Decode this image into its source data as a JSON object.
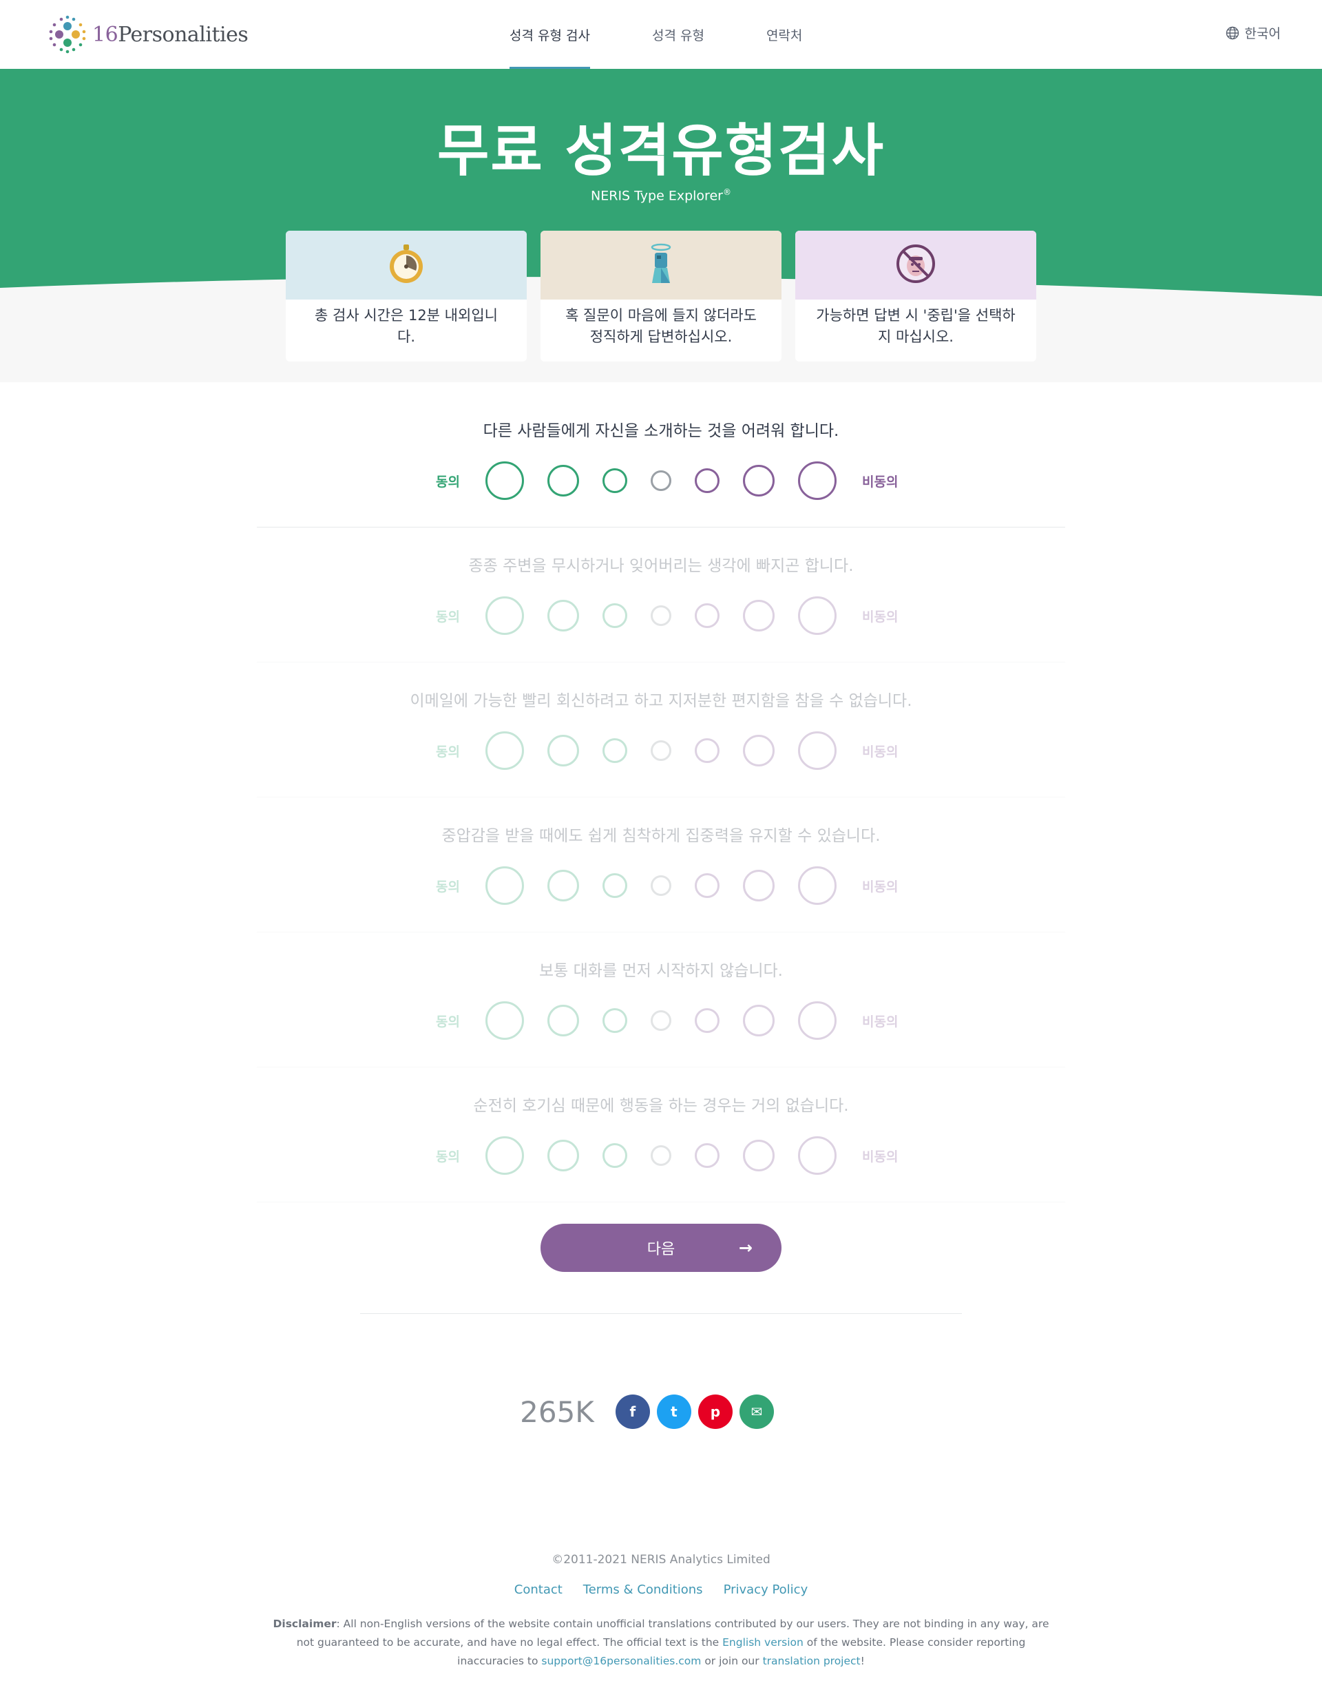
{
  "header": {
    "logo_number": "16",
    "logo_text": "Personalities",
    "nav": [
      {
        "label": "성격 유형 검사",
        "active": true
      },
      {
        "label": "성격 유형",
        "active": false
      },
      {
        "label": "연락처",
        "active": false
      }
    ],
    "language": "한국어"
  },
  "hero": {
    "title": "무료 성격유형검사",
    "subtitle": "NERIS Type Explorer",
    "subtitle_mark": "®",
    "background_color": "#33a474",
    "tips": [
      {
        "icon": "stopwatch-icon",
        "text": "총 검사 시간은 12분 내외입니다.",
        "color": "#d9eaf0"
      },
      {
        "icon": "halo-figure-icon",
        "text": "혹 질문이 마음에 들지 않더라도 정직하게 답변하십시오.",
        "color": "#ede4d6"
      },
      {
        "icon": "no-neutral-face-icon",
        "text": "가능하면 답변 시 '중립'을 선택하지 마십시오.",
        "color": "#ecdff2"
      }
    ]
  },
  "scale": {
    "agree_label": "동의",
    "disagree_label": "비동의",
    "agree_color": "#33a474",
    "disagree_color": "#88619a"
  },
  "questions": [
    {
      "text": "다른 사람들에게 자신을 소개하는 것을 어려워 합니다.",
      "active": true
    },
    {
      "text": "종종 주변을 무시하거나 잊어버리는 생각에 빠지곤 합니다.",
      "active": false
    },
    {
      "text": "이메일에 가능한 빨리 회신하려고 하고 지저분한 편지함을 참을 수 없습니다.",
      "active": false
    },
    {
      "text": "중압감을 받을 때에도 쉽게 침착하게 집중력을 유지할 수 있습니다.",
      "active": false
    },
    {
      "text": "보통 대화를 먼저 시작하지 않습니다.",
      "active": false
    },
    {
      "text": "순전히 호기심 때문에 행동을 하는 경우는 거의 없습니다.",
      "active": false
    }
  ],
  "next_button": {
    "label": "다음",
    "arrow": "→",
    "color": "#88619a"
  },
  "share": {
    "count": "265K",
    "buttons": [
      {
        "name": "facebook",
        "icon": "facebook-icon",
        "glyph": "f",
        "color": "#3b5998"
      },
      {
        "name": "twitter",
        "icon": "twitter-icon",
        "glyph": "t",
        "color": "#1da1f2"
      },
      {
        "name": "pinterest",
        "icon": "pinterest-icon",
        "glyph": "p",
        "color": "#e60023"
      },
      {
        "name": "email",
        "icon": "envelope-icon",
        "glyph": "✉",
        "color": "#33a474"
      }
    ]
  },
  "footer": {
    "copyright": "©2011-2021 NERIS Analytics Limited",
    "links": [
      "Contact",
      "Terms & Conditions",
      "Privacy Policy"
    ],
    "disclaimer_label": "Disclaimer",
    "disclaimer_part1": ": All non-English versions of the website contain unofficial translations contributed by our users. They are not binding in any way, are not guaranteed to be accurate, and have no legal effect. The official text is the ",
    "disclaimer_link1": "English version",
    "disclaimer_part2": " of the website. Please consider reporting inaccuracies to ",
    "disclaimer_link2": "support@16personalities.com",
    "disclaimer_part3": " or join our ",
    "disclaimer_link3": "translation project",
    "disclaimer_part4": "!"
  }
}
